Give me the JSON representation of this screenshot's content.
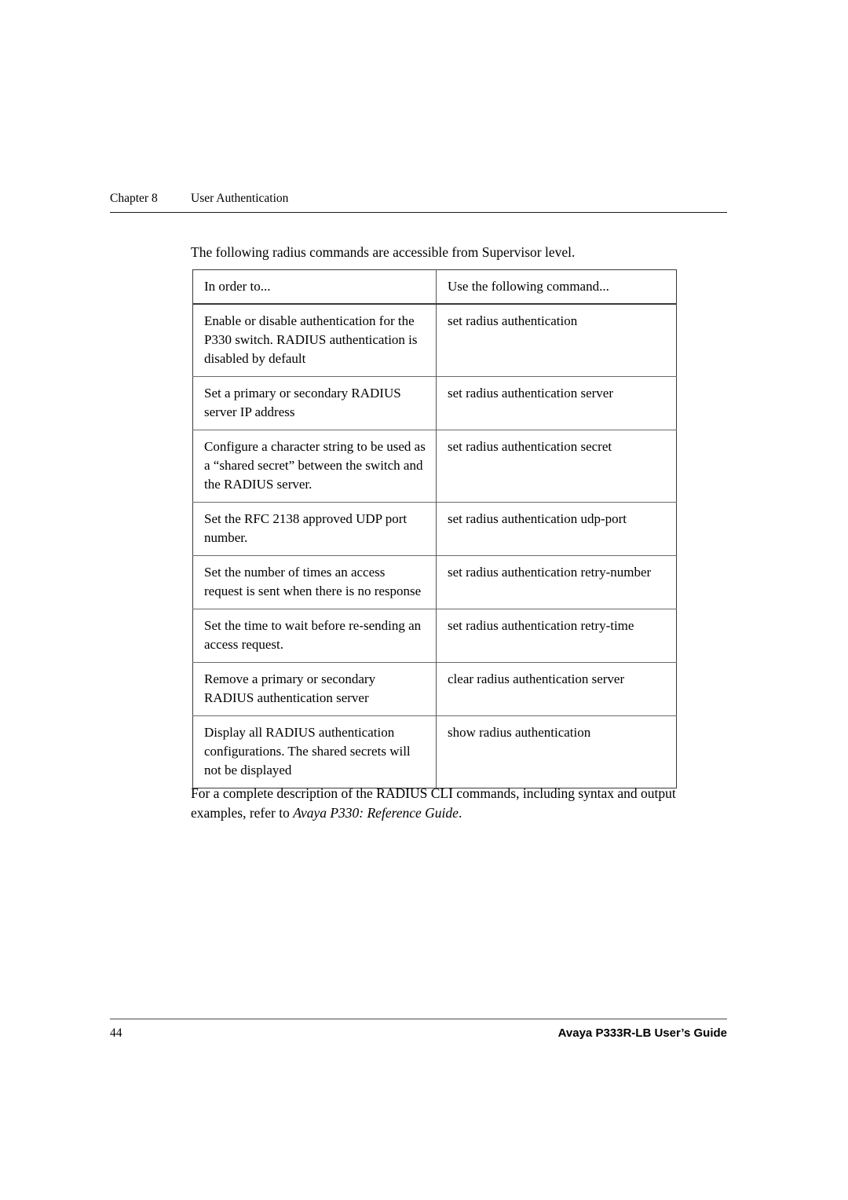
{
  "document": {
    "running_header": {
      "chapter_label": "Chapter 8",
      "chapter_title": "User Authentication"
    },
    "intro_paragraph": "The following radius commands are accessible from Supervisor level.",
    "table": {
      "headers": {
        "intent": "In order to...",
        "command": "Use the following command..."
      },
      "rows": [
        {
          "intent": "Enable or disable authentication for the P330 switch. RADIUS authentication is disabled by default",
          "command": "set radius authentication"
        },
        {
          "intent": "Set a primary or secondary RADIUS server IP address",
          "command": "set radius authentication server"
        },
        {
          "intent": "Configure a character string to be used as a “shared secret” between the switch and the RADIUS server.",
          "command": "set radius authentication secret"
        },
        {
          "intent": "Set the RFC 2138 approved UDP port number.",
          "command": "set radius authentication udp-port"
        },
        {
          "intent": "Set the number of times an access request is sent when there is no response",
          "command": "set radius authentication retry-number"
        },
        {
          "intent": "Set the time to wait before re-sending an access request.",
          "command": "set radius authentication retry-time"
        },
        {
          "intent": "Remove a primary or secondary RADIUS authentication server",
          "command": "clear radius authentication server"
        },
        {
          "intent": "Display all RADIUS authentication configurations. The shared secrets will not be displayed",
          "command": "show radius authentication"
        }
      ]
    },
    "closing_paragraph": {
      "lead": "For a complete description of the RADIUS CLI commands, including syntax and output examples, refer to ",
      "reference_title": "Avaya P330: Reference Guide",
      "trail": "."
    },
    "footer": {
      "page_number": "44",
      "guide_title": "Avaya P333R-LB User’s Guide"
    }
  }
}
